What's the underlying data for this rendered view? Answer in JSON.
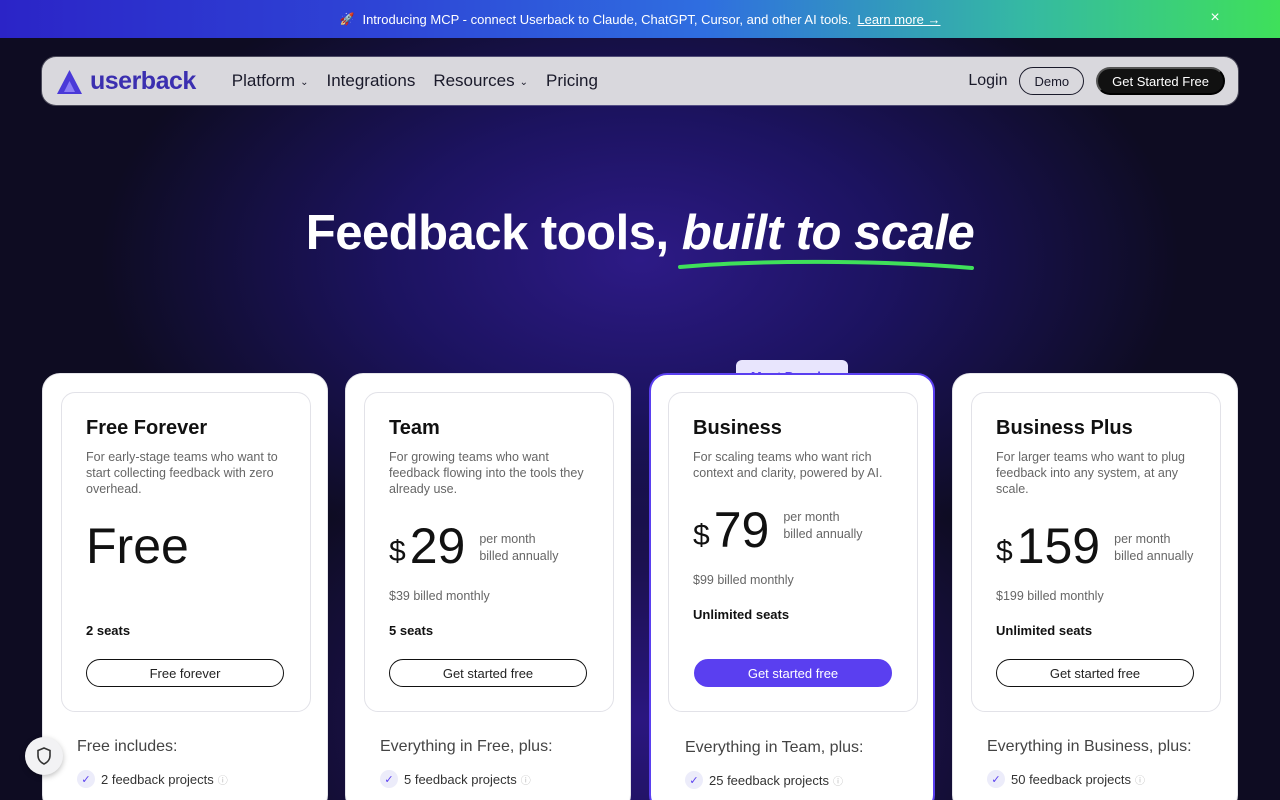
{
  "announcement": {
    "icon": "rocket-icon",
    "text": "Introducing MCP - connect Userback to Claude, ChatGPT, Cursor, and other AI tools.",
    "link": "Learn more →",
    "close": "×"
  },
  "nav": {
    "logo": "userback",
    "items": [
      {
        "label": "Platform",
        "has_dropdown": true
      },
      {
        "label": "Integrations",
        "has_dropdown": false
      },
      {
        "label": "Resources",
        "has_dropdown": true
      },
      {
        "label": "Pricing",
        "has_dropdown": false
      }
    ],
    "login": "Login",
    "demo": "Demo",
    "get_started": "Get Started Free"
  },
  "hero": {
    "title_plain": "Feedback tools, ",
    "title_italic": "built to scale"
  },
  "badge": "Most Popular",
  "plans": [
    {
      "name": "Free Forever",
      "description": "For early-stage teams who want to start collecting feedback with zero overhead.",
      "currency": "",
      "price": "Free",
      "per": "",
      "billed": "",
      "monthly": "",
      "seats": "2 seats",
      "cta": "Free forever",
      "includes": "Free includes:",
      "feature": "2 feedback projects"
    },
    {
      "name": "Team",
      "description": "For growing teams who want feedback flowing into the tools they already use.",
      "currency": "$",
      "price": "29",
      "per": "per month",
      "billed": "billed annually",
      "monthly": "$39 billed monthly",
      "seats": "5 seats",
      "cta": "Get started free",
      "includes": "Everything in Free, plus:",
      "feature": "5 feedback projects"
    },
    {
      "name": "Business",
      "description": "For scaling teams who want rich context and clarity, powered by AI.",
      "currency": "$",
      "price": "79",
      "per": "per month",
      "billed": "billed annually",
      "monthly": "$99 billed monthly",
      "seats": "Unlimited seats",
      "cta": "Get started free",
      "includes": "Everything in Team, plus:",
      "feature": "25 feedback projects"
    },
    {
      "name": "Business Plus",
      "description": "For larger teams who want to plug feedback into any system, at any scale.",
      "currency": "$",
      "price": "159",
      "per": "per month",
      "billed": "billed annually",
      "monthly": "$199 billed monthly",
      "seats": "Unlimited seats",
      "cta": "Get started free",
      "includes": "Everything in Business, plus:",
      "feature": "50 feedback projects"
    }
  ],
  "colors": {
    "accent": "#5a3ff0",
    "brand": "#3b2fb0",
    "underline": "#3fe05a"
  }
}
